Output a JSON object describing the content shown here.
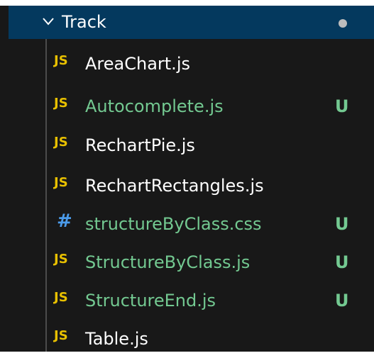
{
  "folder": {
    "name": "Track",
    "expanded": true,
    "chevron_icon": "chevron-down-icon",
    "has_modified_indicator": true
  },
  "colors": {
    "untracked": "#73c991",
    "normal_text": "#ffffff",
    "js_icon": "#e8c000",
    "css_icon": "#4b9bea",
    "folder_selected_bg": "#04395e",
    "panel_bg": "#181818"
  },
  "files": [
    {
      "icon_text": "JS",
      "icon": "js-icon",
      "name": "AreaChart.js",
      "status": "",
      "untracked": false
    },
    {
      "icon_text": "JS",
      "icon": "js-icon",
      "name": "Autocomplete.js",
      "status": "U",
      "untracked": true
    },
    {
      "icon_text": "JS",
      "icon": "js-icon",
      "name": "RechartPie.js",
      "status": "",
      "untracked": false
    },
    {
      "icon_text": "JS",
      "icon": "js-icon",
      "name": "RechartRectangles.js",
      "status": "",
      "untracked": false
    },
    {
      "icon_text": "#",
      "icon": "css-icon",
      "name": "structureByClass.css",
      "status": "U",
      "untracked": true
    },
    {
      "icon_text": "JS",
      "icon": "js-icon",
      "name": "StructureByClass.js",
      "status": "U",
      "untracked": true
    },
    {
      "icon_text": "JS",
      "icon": "js-icon",
      "name": "StructureEnd.js",
      "status": "U",
      "untracked": true
    },
    {
      "icon_text": "JS",
      "icon": "js-icon",
      "name": "Table.js",
      "status": "",
      "untracked": false
    }
  ]
}
